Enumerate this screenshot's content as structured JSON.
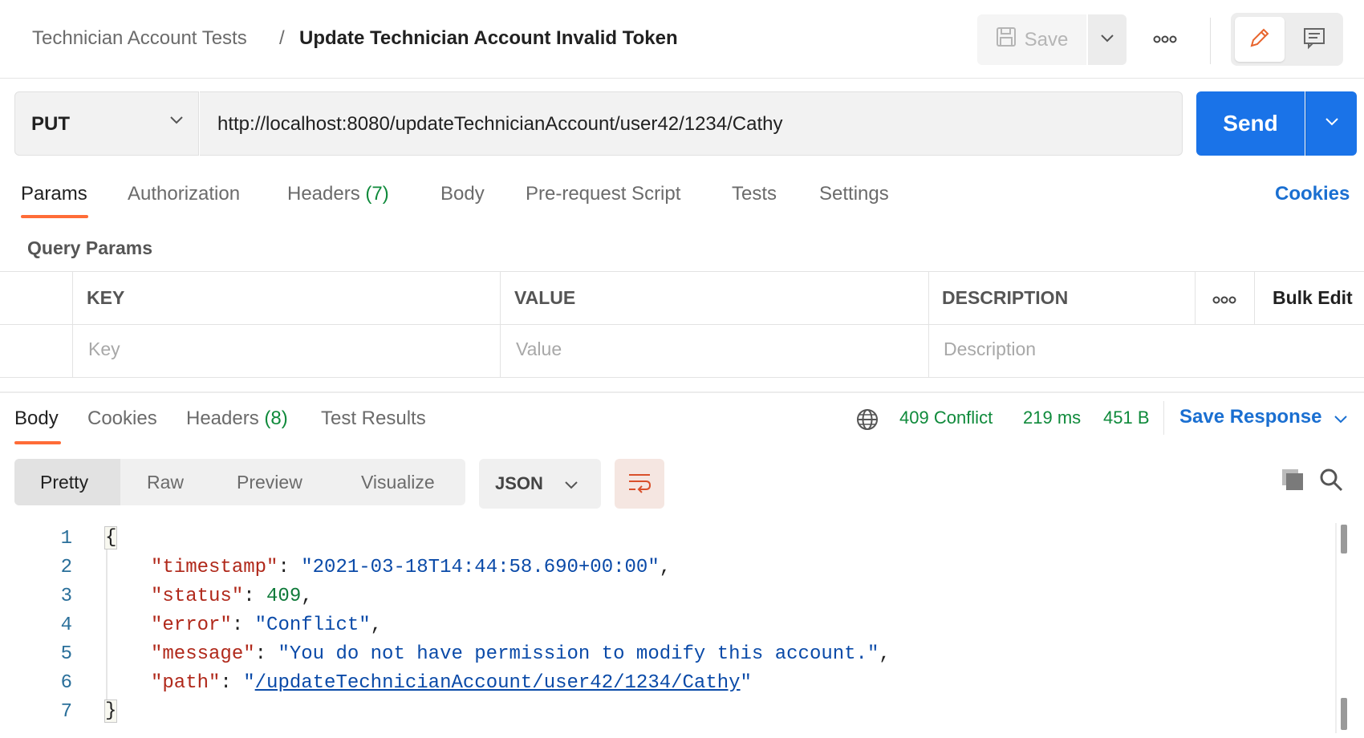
{
  "header": {
    "breadcrumb_parent": "Technician Account Tests",
    "breadcrumb_separator": "/",
    "request_name": "Update Technician Account Invalid Token",
    "save_label": "Save"
  },
  "request": {
    "method": "PUT",
    "url": "http://localhost:8080/updateTechnicianAccount/user42/1234/Cathy",
    "send_label": "Send"
  },
  "request_tabs": {
    "params": "Params",
    "authorization": "Authorization",
    "headers": "Headers",
    "headers_count": "(7)",
    "body": "Body",
    "prerequest": "Pre-request Script",
    "tests": "Tests",
    "settings": "Settings",
    "cookies": "Cookies"
  },
  "query_params": {
    "title": "Query Params",
    "columns": [
      "KEY",
      "VALUE",
      "DESCRIPTION"
    ],
    "bulk_edit": "Bulk Edit",
    "placeholders": {
      "key": "Key",
      "value": "Value",
      "description": "Description"
    }
  },
  "response_tabs": {
    "body": "Body",
    "cookies": "Cookies",
    "headers": "Headers",
    "headers_count": "(8)",
    "test_results": "Test Results"
  },
  "response_meta": {
    "status": "409 Conflict",
    "time": "219 ms",
    "size": "451 B",
    "save_response": "Save Response"
  },
  "view": {
    "modes": [
      "Pretty",
      "Raw",
      "Preview",
      "Visualize"
    ],
    "active_mode": "Pretty",
    "format": "JSON"
  },
  "response_body": {
    "line_numbers": [
      "1",
      "2",
      "3",
      "4",
      "5",
      "6",
      "7"
    ],
    "open_brace": "{",
    "close_brace": "}",
    "fields": [
      {
        "key": "\"timestamp\"",
        "value": "\"2021-03-18T14:44:58.690+00:00\"",
        "trail": ","
      },
      {
        "key": "\"status\"",
        "value": "409",
        "trail": ","
      },
      {
        "key": "\"error\"",
        "value": "\"Conflict\"",
        "trail": ","
      },
      {
        "key": "\"message\"",
        "value": "\"You do not have permission to modify this account.\"",
        "trail": ","
      },
      {
        "key": "\"path\"",
        "value_open": "\"",
        "value_link": "/updateTechnicianAccount/user42/1234/Cathy",
        "value_close": "\"",
        "trail": ""
      }
    ]
  },
  "colors": {
    "accent_blue": "#1a73e8",
    "tab_underline": "#ff6c37",
    "status_green": "#0f8a3b",
    "link_blue": "#1a6fd1"
  },
  "icons": [
    "save-icon",
    "chevron-down-icon",
    "more-horizontal-icon",
    "pencil-icon",
    "comment-icon",
    "globe-icon",
    "copy-icon",
    "search-icon",
    "wrap-lines-icon"
  ]
}
